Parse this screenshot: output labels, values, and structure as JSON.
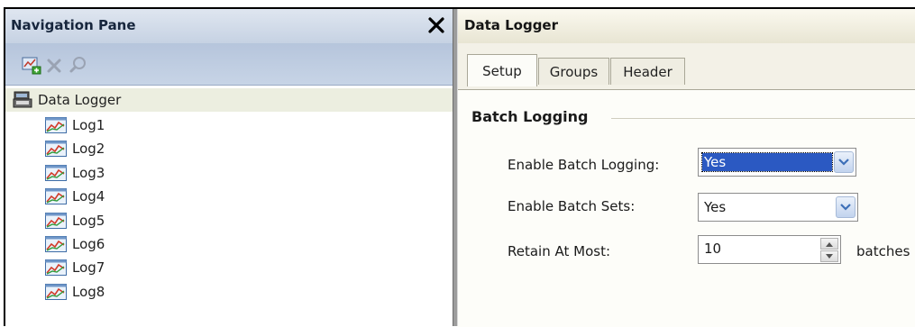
{
  "nav": {
    "title": "Navigation Pane",
    "close_symbol": "✕",
    "toolbar": [
      {
        "icon": "add-log-icon"
      },
      {
        "icon": "delete-icon"
      },
      {
        "icon": "search-icon"
      }
    ],
    "tree": {
      "root": {
        "label": "Data Logger",
        "icon": "data-logger-icon"
      },
      "items": [
        {
          "label": "Log1",
          "icon": "log-chart-icon"
        },
        {
          "label": "Log2",
          "icon": "log-chart-icon"
        },
        {
          "label": "Log3",
          "icon": "log-chart-icon"
        },
        {
          "label": "Log4",
          "icon": "log-chart-icon"
        },
        {
          "label": "Log5",
          "icon": "log-chart-icon"
        },
        {
          "label": "Log6",
          "icon": "log-chart-icon"
        },
        {
          "label": "Log7",
          "icon": "log-chart-icon"
        },
        {
          "label": "Log8",
          "icon": "log-chart-icon"
        }
      ]
    }
  },
  "panel": {
    "title": "Data Logger",
    "tabs": [
      {
        "label": "Setup",
        "active": true
      },
      {
        "label": "Groups",
        "active": false
      },
      {
        "label": "Header",
        "active": false
      }
    ],
    "group_title": "Batch Logging",
    "enable_batch_logging": {
      "label": "Enable Batch Logging:",
      "value": "Yes"
    },
    "enable_batch_sets": {
      "label": "Enable Batch Sets:",
      "value": "Yes"
    },
    "retain_at_most": {
      "label": "Retain At Most:",
      "value": "10",
      "unit": "batches"
    }
  },
  "colors": {
    "nav_header": "#c6d2e3",
    "panel_bg": "#f3f1e7",
    "selection": "#2b59c2"
  }
}
